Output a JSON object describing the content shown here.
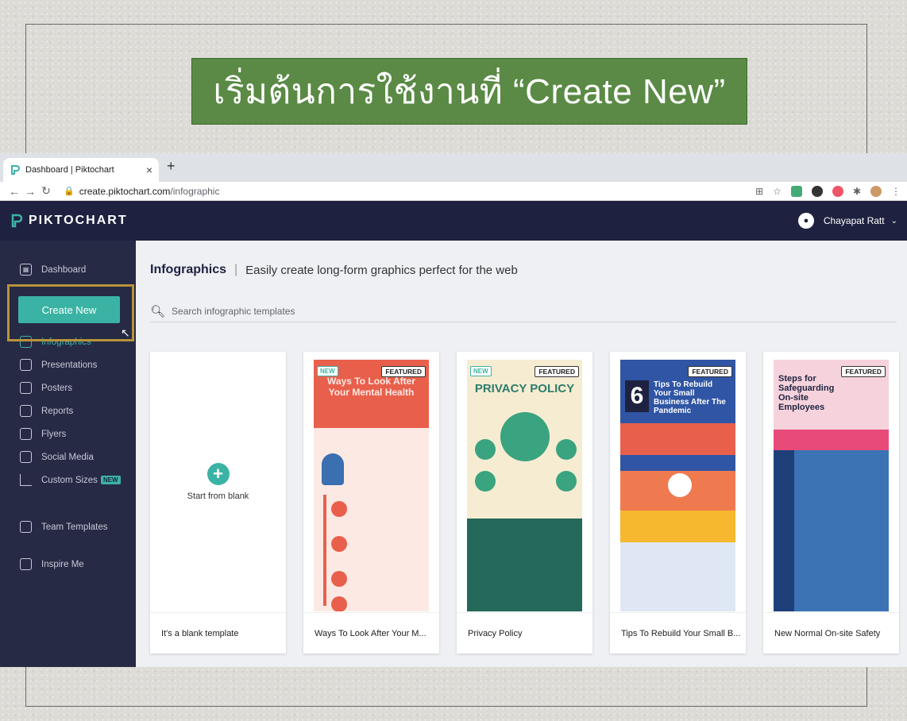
{
  "slide": {
    "title": "เริ่มต้นการใช้งานที่ “Create New”"
  },
  "browser": {
    "tab_title": "Dashboard | Piktochart",
    "tab_close": "×",
    "new_tab": "+",
    "url_host": "create.piktochart.com",
    "url_path": "/infographic"
  },
  "app": {
    "logo": "PIKTOCHART",
    "user_name": "Chayapat Ratt"
  },
  "sidebar": {
    "items": [
      {
        "label": "Dashboard"
      },
      {
        "label": "Infographics"
      },
      {
        "label": "Presentations"
      },
      {
        "label": "Posters"
      },
      {
        "label": "Reports"
      },
      {
        "label": "Flyers"
      },
      {
        "label": "Social Media"
      },
      {
        "label": "Custom Sizes"
      },
      {
        "label": "Team Templates"
      },
      {
        "label": "Inspire Me"
      }
    ],
    "create_new": "Create New",
    "new_badge": "NEW"
  },
  "content": {
    "heading": "Infographics",
    "separator": "|",
    "subheading": "Easily create long-form graphics perfect for the web",
    "search_placeholder": "Search infographic templates",
    "blank_label": "Start from blank",
    "cards": [
      {
        "caption": "It's a blank template"
      },
      {
        "caption": "Ways To Look After Your M...",
        "badge_new": "NEW",
        "badge_featured": "FEATURED",
        "thumb_title": "Ways To Look After Your Mental Health"
      },
      {
        "caption": "Privacy Policy",
        "badge_new": "NEW",
        "badge_featured": "FEATURED",
        "thumb_title": "PRIVACY POLICY"
      },
      {
        "caption": "Tips To Rebuild Your Small B...",
        "badge_featured": "FEATURED",
        "thumb_title": "Tips To Rebuild Your Small Business After The Pandemic",
        "thumb_number": "6"
      },
      {
        "caption": "New Normal On-site Safety",
        "badge_featured": "FEATURED",
        "thumb_title": "Steps for Safeguarding On-site Employees"
      }
    ]
  },
  "colors": {
    "header_bg": "#1e2240",
    "sidebar_bg": "#262a45",
    "accent": "#3bb3a4",
    "slide_title_bg": "#5a8a45",
    "highlight": "#b8933a"
  }
}
